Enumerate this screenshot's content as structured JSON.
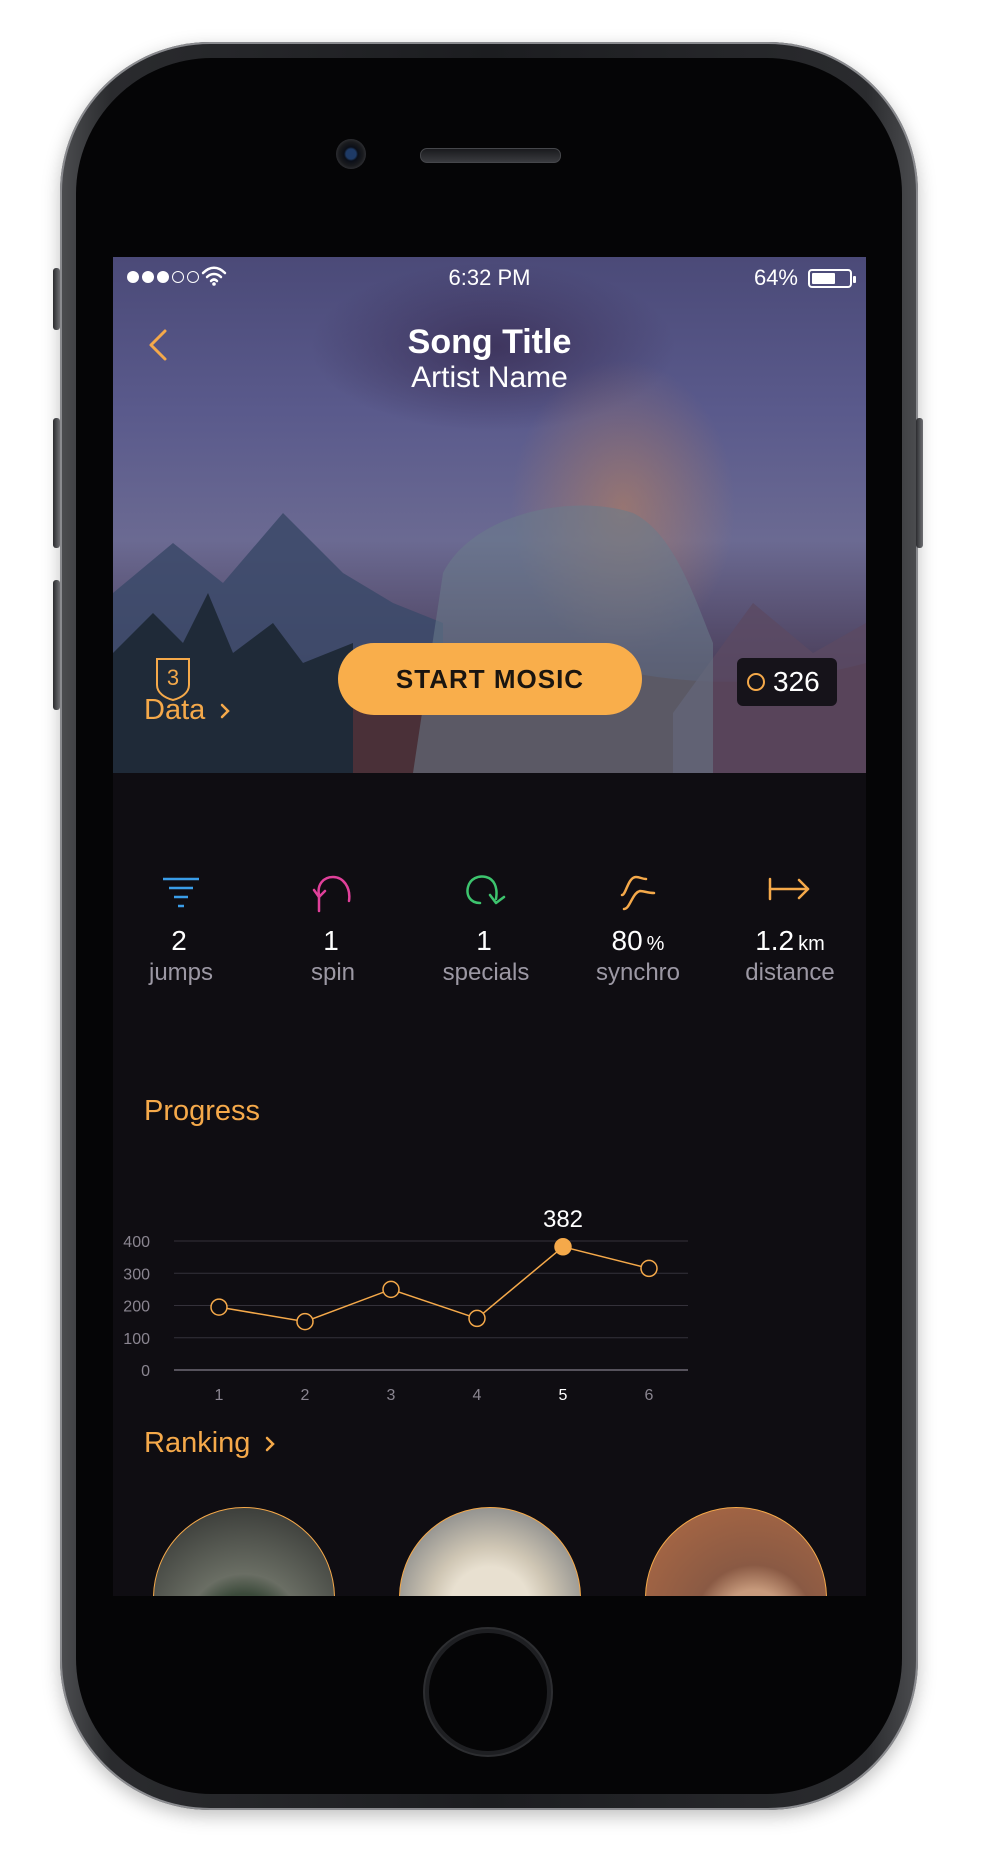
{
  "status_bar": {
    "signal_filled": 3,
    "signal_total": 5,
    "time": "6:32 PM",
    "battery_percent": "64%",
    "battery_level": 0.64
  },
  "header": {
    "song_title": "Song Title",
    "artist_name": "Artist Name"
  },
  "hero": {
    "level": "3",
    "start_label": "START MOSIC",
    "coins": "326",
    "accent": "#f9ae4b"
  },
  "data_section": {
    "title": "Data",
    "stats": [
      {
        "icon": "jumps-icon",
        "value": "2",
        "unit": "",
        "label": "jumps",
        "color": "#3a9de8"
      },
      {
        "icon": "spin-icon",
        "value": "1",
        "unit": "",
        "label": "spin",
        "color": "#e0409a"
      },
      {
        "icon": "specials-icon",
        "value": "1",
        "unit": "",
        "label": "specials",
        "color": "#3dc46e"
      },
      {
        "icon": "synchro-icon",
        "value": "80",
        "unit": "%",
        "label": "synchro",
        "color": "#f5a94a"
      },
      {
        "icon": "distance-icon",
        "value": "1.2",
        "unit": "km",
        "label": "distance",
        "color": "#f5a94a"
      }
    ]
  },
  "progress_section": {
    "title": "Progress"
  },
  "chart_data": {
    "type": "line",
    "title": "Progress",
    "x": [
      "1",
      "2",
      "3",
      "4",
      "5",
      "6"
    ],
    "values": [
      195,
      150,
      250,
      160,
      382,
      315
    ],
    "highlight_index": 4,
    "highlight_label": "382",
    "y_ticks": [
      "0",
      "100",
      "200",
      "300",
      "400"
    ],
    "ylim": [
      0,
      400
    ],
    "grid": true,
    "line_color": "#f5a94a"
  },
  "ranking_section": {
    "title": "Ranking",
    "avatars": [
      "ranking-avatar-1",
      "ranking-avatar-2",
      "ranking-avatar-3"
    ]
  }
}
